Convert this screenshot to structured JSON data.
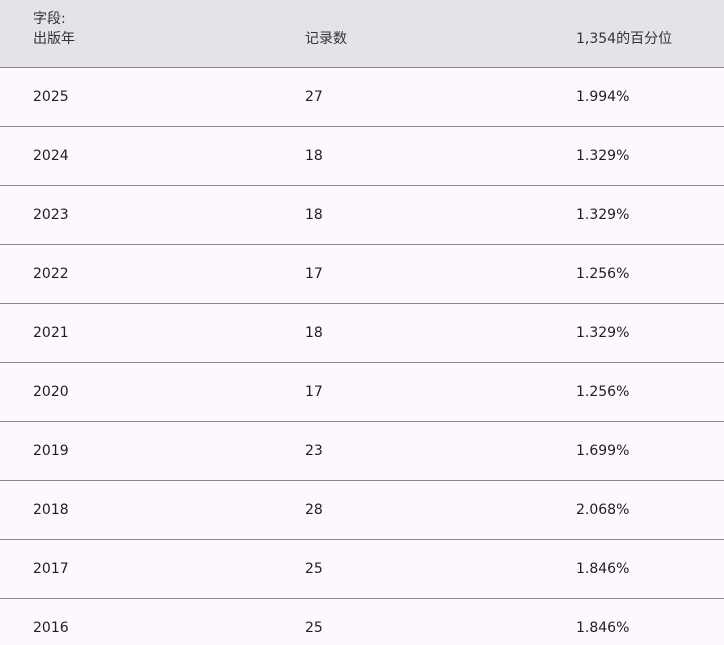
{
  "table": {
    "header": {
      "field_prefix": "字段:",
      "field_name": "出版年",
      "count": "记录数",
      "percent": "1,354的百分位"
    },
    "rows": [
      {
        "year": "2025",
        "count": "27",
        "percent": "1.994%"
      },
      {
        "year": "2024",
        "count": "18",
        "percent": "1.329%"
      },
      {
        "year": "2023",
        "count": "18",
        "percent": "1.329%"
      },
      {
        "year": "2022",
        "count": "17",
        "percent": "1.256%"
      },
      {
        "year": "2021",
        "count": "18",
        "percent": "1.329%"
      },
      {
        "year": "2020",
        "count": "17",
        "percent": "1.256%"
      },
      {
        "year": "2019",
        "count": "23",
        "percent": "1.699%"
      },
      {
        "year": "2018",
        "count": "28",
        "percent": "2.068%"
      },
      {
        "year": "2017",
        "count": "25",
        "percent": "1.846%"
      },
      {
        "year": "2016",
        "count": "25",
        "percent": "1.846%"
      }
    ]
  }
}
